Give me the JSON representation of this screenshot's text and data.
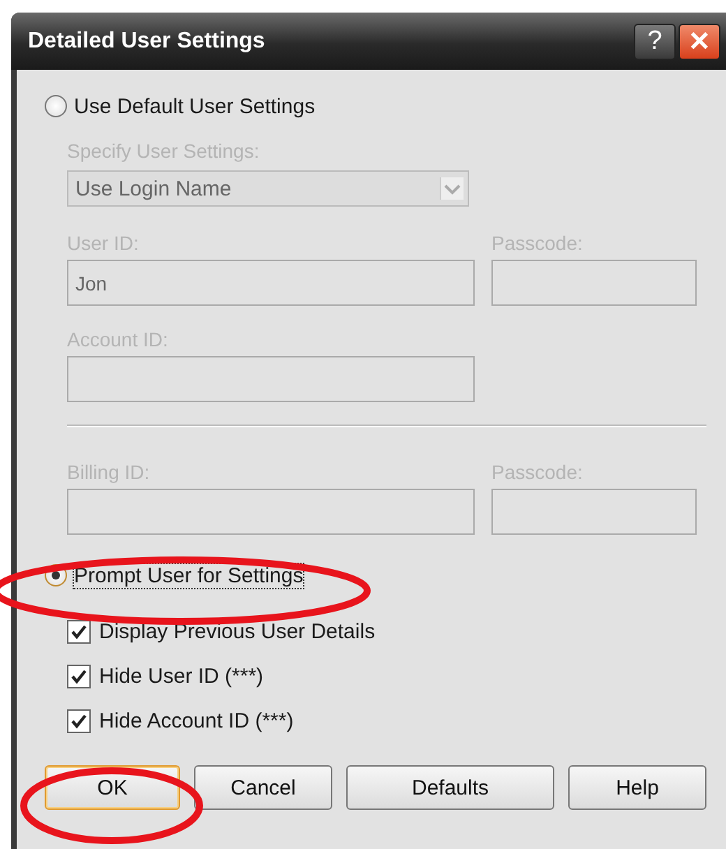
{
  "window": {
    "title": "Detailed User Settings",
    "help_button": "?",
    "close_button": "✕"
  },
  "options": [
    {
      "label": "Use Default User Settings",
      "selected": false
    },
    {
      "label": "Prompt User for Settings",
      "selected": true
    }
  ],
  "specify": {
    "label": "Specify User Settings:",
    "value": "Use Login Name",
    "disabled": true,
    "rows": [
      {
        "kind": "fields",
        "fields": [
          {
            "label": "User ID:",
            "value": "Jon",
            "kind": "wide"
          },
          {
            "label": "Passcode:",
            "kind": "narrow"
          }
        ]
      },
      {
        "kind": "fields",
        "fields": [
          {
            "label": "Account ID:",
            "kind": "wide"
          }
        ]
      },
      {
        "kind": "separator"
      },
      {
        "kind": "fields",
        "fields": [
          {
            "label": "Billing ID:",
            "kind": "wide"
          },
          {
            "label": "Passcode:",
            "kind": "narrow"
          }
        ]
      }
    ]
  },
  "checkboxes": [
    {
      "label": "Display Previous User Details",
      "checked": true
    },
    {
      "label": "Hide User ID (***)",
      "checked": true
    },
    {
      "label": "Hide Account ID (***)",
      "checked": true
    }
  ],
  "buttons": [
    {
      "label": "OK",
      "default": true
    },
    {
      "label": "Cancel",
      "default": false
    },
    {
      "label": "Defaults",
      "default": false
    },
    {
      "label": "Help",
      "default": false
    }
  ],
  "annotations": [
    {
      "kind": "ellipse"
    },
    {
      "kind": "ellipse"
    }
  ]
}
